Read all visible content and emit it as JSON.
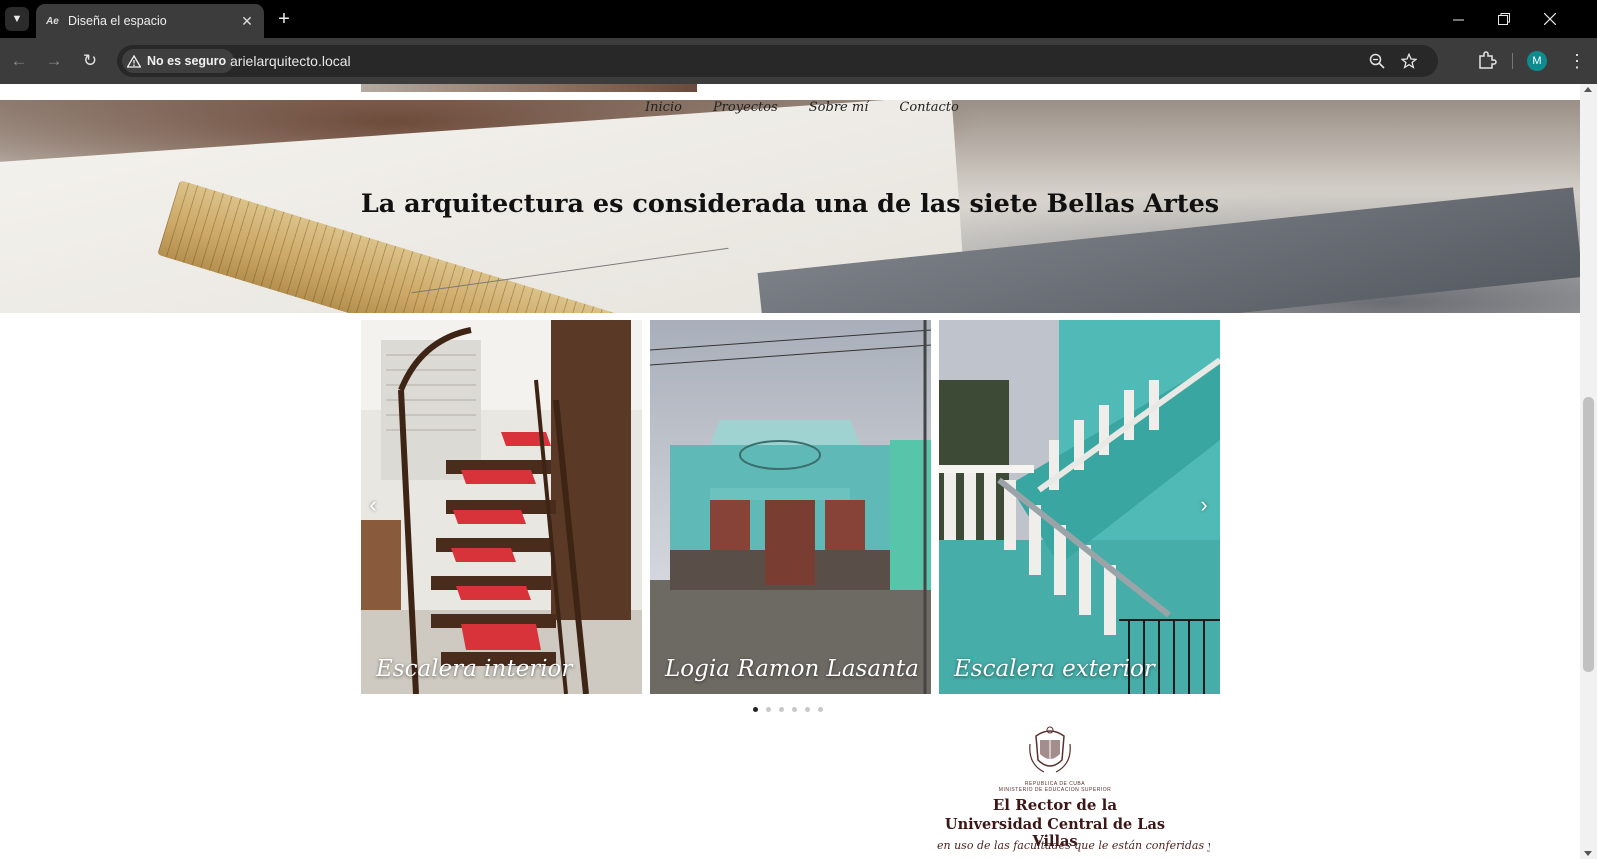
{
  "browser": {
    "tab_title": "Diseña el espacio",
    "favicon_text": "Ae",
    "security_label": "No es seguro",
    "url": "arielarquitecto.local",
    "profile_initial": "M"
  },
  "site": {
    "nav": [
      "Inicio",
      "Proyectos",
      "Sobre mí",
      "Contacto"
    ],
    "hero_title": "La arquitectura es considerada una de las siete Bellas Artes",
    "carousel": {
      "slides": [
        {
          "caption": "Escalera interior"
        },
        {
          "caption": "Logia Ramon Lasanta"
        },
        {
          "caption": "Escalera exterior"
        }
      ],
      "dot_count": 6,
      "active_dot": 0
    },
    "diploma": {
      "header_small_1": "REPUBLICA DE CUBA",
      "header_small_2": "MINISTERIO DE EDUCACION SUPERIOR",
      "line1": "El Rector de la",
      "line2": "Universidad Central de Las Villas",
      "line3": "en uso de las facultades que le están conferidas y a"
    }
  },
  "colors": {
    "chrome_dark": "#000000",
    "toolbar": "#3c3c3c",
    "avatar": "#0d8b8e"
  }
}
